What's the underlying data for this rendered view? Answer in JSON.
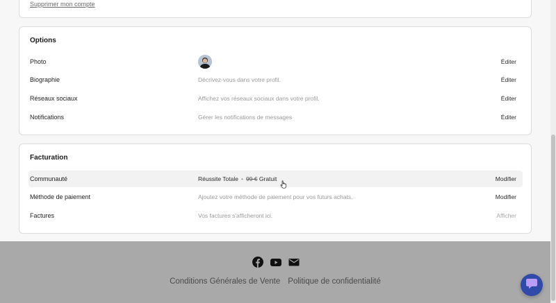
{
  "account": {
    "delete_label": "Supprimer mon compte"
  },
  "options": {
    "title": "Options",
    "rows": [
      {
        "label": "Photo",
        "value": "",
        "action": "Éditer"
      },
      {
        "label": "Biographie",
        "value": "Décrivez-vous dans votre profil.",
        "action": "Éditer"
      },
      {
        "label": "Réseaux sociaux",
        "value": "Affichez vos réseaux sociaux dans votre profil.",
        "action": "Éditer"
      },
      {
        "label": "Notifications",
        "value": "Gérer les notifications de messages",
        "action": "Éditer"
      }
    ]
  },
  "billing": {
    "title": "Facturation",
    "rows": [
      {
        "label": "Communauté",
        "plan": "Réussite Totale",
        "separator": "•",
        "old_price": "99 €",
        "price": "Gratuit",
        "action": "Modifier"
      },
      {
        "label": "Méthode de paiement",
        "value": "Ajoutez votre méthode de paiement pour vos futurs achats.",
        "action": "Modifier"
      },
      {
        "label": "Factures",
        "value": "Vos factures s'afficheront ici.",
        "action": "Afficher"
      }
    ]
  },
  "footer": {
    "social_icons": [
      "facebook-icon",
      "youtube-icon",
      "mail-icon"
    ],
    "links": [
      "Conditions Générales de Vente",
      "Politique de confidentialité"
    ]
  },
  "colors": {
    "footer_bg": "#a9a9a9",
    "chat_button": "#2f4aa8",
    "card_bg": "#ffffff",
    "page_bg": "#f7f7f7"
  }
}
